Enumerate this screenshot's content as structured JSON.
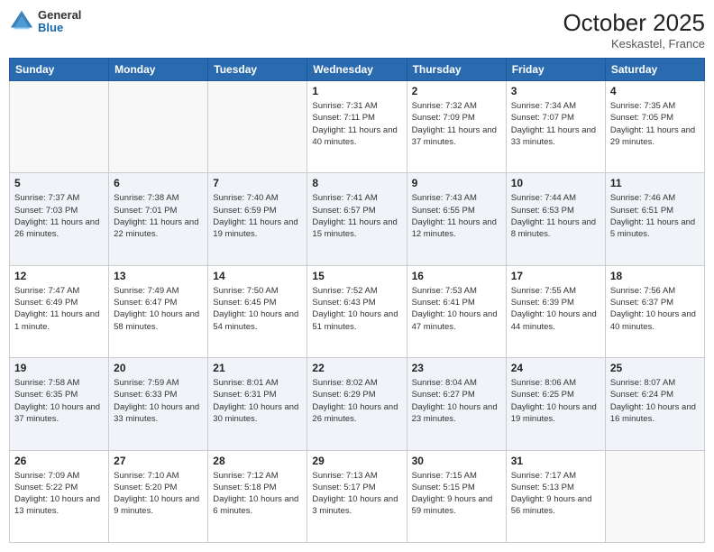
{
  "header": {
    "logo_general": "General",
    "logo_blue": "Blue",
    "month_title": "October 2025",
    "location": "Keskastel, France"
  },
  "days_of_week": [
    "Sunday",
    "Monday",
    "Tuesday",
    "Wednesday",
    "Thursday",
    "Friday",
    "Saturday"
  ],
  "weeks": [
    {
      "shade": false,
      "days": [
        {
          "num": "",
          "info": ""
        },
        {
          "num": "",
          "info": ""
        },
        {
          "num": "",
          "info": ""
        },
        {
          "num": "1",
          "info": "Sunrise: 7:31 AM\nSunset: 7:11 PM\nDaylight: 11 hours\nand 40 minutes."
        },
        {
          "num": "2",
          "info": "Sunrise: 7:32 AM\nSunset: 7:09 PM\nDaylight: 11 hours\nand 37 minutes."
        },
        {
          "num": "3",
          "info": "Sunrise: 7:34 AM\nSunset: 7:07 PM\nDaylight: 11 hours\nand 33 minutes."
        },
        {
          "num": "4",
          "info": "Sunrise: 7:35 AM\nSunset: 7:05 PM\nDaylight: 11 hours\nand 29 minutes."
        }
      ]
    },
    {
      "shade": true,
      "days": [
        {
          "num": "5",
          "info": "Sunrise: 7:37 AM\nSunset: 7:03 PM\nDaylight: 11 hours\nand 26 minutes."
        },
        {
          "num": "6",
          "info": "Sunrise: 7:38 AM\nSunset: 7:01 PM\nDaylight: 11 hours\nand 22 minutes."
        },
        {
          "num": "7",
          "info": "Sunrise: 7:40 AM\nSunset: 6:59 PM\nDaylight: 11 hours\nand 19 minutes."
        },
        {
          "num": "8",
          "info": "Sunrise: 7:41 AM\nSunset: 6:57 PM\nDaylight: 11 hours\nand 15 minutes."
        },
        {
          "num": "9",
          "info": "Sunrise: 7:43 AM\nSunset: 6:55 PM\nDaylight: 11 hours\nand 12 minutes."
        },
        {
          "num": "10",
          "info": "Sunrise: 7:44 AM\nSunset: 6:53 PM\nDaylight: 11 hours\nand 8 minutes."
        },
        {
          "num": "11",
          "info": "Sunrise: 7:46 AM\nSunset: 6:51 PM\nDaylight: 11 hours\nand 5 minutes."
        }
      ]
    },
    {
      "shade": false,
      "days": [
        {
          "num": "12",
          "info": "Sunrise: 7:47 AM\nSunset: 6:49 PM\nDaylight: 11 hours\nand 1 minute."
        },
        {
          "num": "13",
          "info": "Sunrise: 7:49 AM\nSunset: 6:47 PM\nDaylight: 10 hours\nand 58 minutes."
        },
        {
          "num": "14",
          "info": "Sunrise: 7:50 AM\nSunset: 6:45 PM\nDaylight: 10 hours\nand 54 minutes."
        },
        {
          "num": "15",
          "info": "Sunrise: 7:52 AM\nSunset: 6:43 PM\nDaylight: 10 hours\nand 51 minutes."
        },
        {
          "num": "16",
          "info": "Sunrise: 7:53 AM\nSunset: 6:41 PM\nDaylight: 10 hours\nand 47 minutes."
        },
        {
          "num": "17",
          "info": "Sunrise: 7:55 AM\nSunset: 6:39 PM\nDaylight: 10 hours\nand 44 minutes."
        },
        {
          "num": "18",
          "info": "Sunrise: 7:56 AM\nSunset: 6:37 PM\nDaylight: 10 hours\nand 40 minutes."
        }
      ]
    },
    {
      "shade": true,
      "days": [
        {
          "num": "19",
          "info": "Sunrise: 7:58 AM\nSunset: 6:35 PM\nDaylight: 10 hours\nand 37 minutes."
        },
        {
          "num": "20",
          "info": "Sunrise: 7:59 AM\nSunset: 6:33 PM\nDaylight: 10 hours\nand 33 minutes."
        },
        {
          "num": "21",
          "info": "Sunrise: 8:01 AM\nSunset: 6:31 PM\nDaylight: 10 hours\nand 30 minutes."
        },
        {
          "num": "22",
          "info": "Sunrise: 8:02 AM\nSunset: 6:29 PM\nDaylight: 10 hours\nand 26 minutes."
        },
        {
          "num": "23",
          "info": "Sunrise: 8:04 AM\nSunset: 6:27 PM\nDaylight: 10 hours\nand 23 minutes."
        },
        {
          "num": "24",
          "info": "Sunrise: 8:06 AM\nSunset: 6:25 PM\nDaylight: 10 hours\nand 19 minutes."
        },
        {
          "num": "25",
          "info": "Sunrise: 8:07 AM\nSunset: 6:24 PM\nDaylight: 10 hours\nand 16 minutes."
        }
      ]
    },
    {
      "shade": false,
      "days": [
        {
          "num": "26",
          "info": "Sunrise: 7:09 AM\nSunset: 5:22 PM\nDaylight: 10 hours\nand 13 minutes."
        },
        {
          "num": "27",
          "info": "Sunrise: 7:10 AM\nSunset: 5:20 PM\nDaylight: 10 hours\nand 9 minutes."
        },
        {
          "num": "28",
          "info": "Sunrise: 7:12 AM\nSunset: 5:18 PM\nDaylight: 10 hours\nand 6 minutes."
        },
        {
          "num": "29",
          "info": "Sunrise: 7:13 AM\nSunset: 5:17 PM\nDaylight: 10 hours\nand 3 minutes."
        },
        {
          "num": "30",
          "info": "Sunrise: 7:15 AM\nSunset: 5:15 PM\nDaylight: 9 hours\nand 59 minutes."
        },
        {
          "num": "31",
          "info": "Sunrise: 7:17 AM\nSunset: 5:13 PM\nDaylight: 9 hours\nand 56 minutes."
        },
        {
          "num": "",
          "info": ""
        }
      ]
    }
  ]
}
